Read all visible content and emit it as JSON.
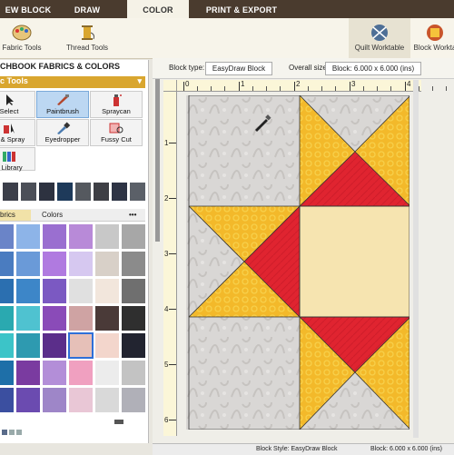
{
  "tabs": [
    {
      "label": "EW BLOCK",
      "active": false
    },
    {
      "label": "DRAW",
      "active": false
    },
    {
      "label": "COLOR",
      "active": true
    },
    {
      "label": "PRINT & EXPORT",
      "active": false
    }
  ],
  "ribbon": {
    "fabric_tools": "Fabric Tools",
    "thread_tools": "Thread Tools",
    "quilt_worktable": "Quilt Worktable",
    "block_worktable": "Block Workta"
  },
  "left_panel": {
    "title": "CHBOOK FABRICS & COLORS",
    "tools_header": "c Tools",
    "tools": [
      "Select",
      "Paintbrush",
      "Spraycan",
      "ct & Spray",
      "Eyedropper",
      "Fussy Cut",
      "n Library"
    ],
    "subtabs": {
      "fabrics": "brics",
      "colors": "Colors",
      "more": "•••"
    }
  },
  "block_bar": {
    "type_label": "Block type:",
    "type_value": "EasyDraw Block",
    "size_label": "Overall size:",
    "size_value": "Block: 6.000 x 6.000 (ins)"
  },
  "ruler": {
    "h_ticks": [
      "0",
      "1",
      "2",
      "3",
      "4"
    ],
    "v_ticks": [
      "1",
      "2",
      "3",
      "4",
      "5",
      "6"
    ]
  },
  "status": {
    "style": "Block Style: EasyDraw Block",
    "size": "Block: 6.000 x 6.000 (ins)"
  },
  "colors": {
    "tab_bar": "#4a3b2e",
    "accent": "#d9a62f",
    "red": "#e02430",
    "yellow": "#f3b92a",
    "cream": "#f6e4b0",
    "background_fabric": "#d9d7d5"
  },
  "icons": {
    "fabric_tools": "palette-icon",
    "thread_tools": "spool-icon",
    "quilt_worktable": "quilt-icon",
    "block_worktable": "block-icon"
  }
}
